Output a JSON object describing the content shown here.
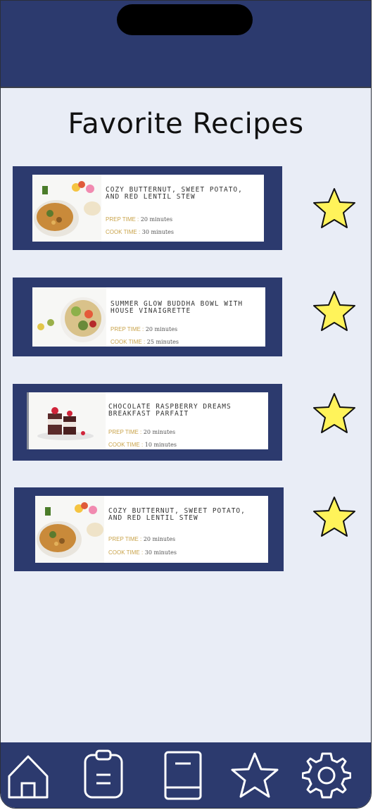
{
  "page": {
    "title": "Favorite Recipes"
  },
  "recipes": [
    {
      "title": "Cozy Butternut, Sweet Potato, and Red Lentil Stew",
      "prep_label": "PREP TIME :",
      "prep_value": "20 minutes",
      "cook_label": "COOK TIME :",
      "cook_value": "30 minutes",
      "favorite": true
    },
    {
      "title": "Summer Glow Buddha Bowl with House Vinaigrette",
      "prep_label": "PREP TIME :",
      "prep_value": "20 minutes",
      "cook_label": "COOK TIME :",
      "cook_value": "25 minutes",
      "favorite": true
    },
    {
      "title": "Chocolate Raspberry Dreams Breakfast Parfait",
      "prep_label": "PREP TIME :",
      "prep_value": "20 minutes",
      "cook_label": "COOK TIME :",
      "cook_value": "10 minutes",
      "favorite": true
    },
    {
      "title": "Cozy Butternut, Sweet Potato, and Red Lentil Stew",
      "prep_label": "PREP TIME :",
      "prep_value": "20 minutes",
      "cook_label": "COOK TIME :",
      "cook_value": "30 minutes",
      "favorite": true
    }
  ],
  "nav": {
    "items": [
      {
        "icon": "home-icon"
      },
      {
        "icon": "clipboard-icon"
      },
      {
        "icon": "book-icon"
      },
      {
        "icon": "star-icon"
      },
      {
        "icon": "gear-icon"
      }
    ]
  },
  "colors": {
    "navy": "#2c3a6e",
    "background": "#e9edf6",
    "star_fill": "#fff35a",
    "accent_gold": "#c9a34a"
  }
}
